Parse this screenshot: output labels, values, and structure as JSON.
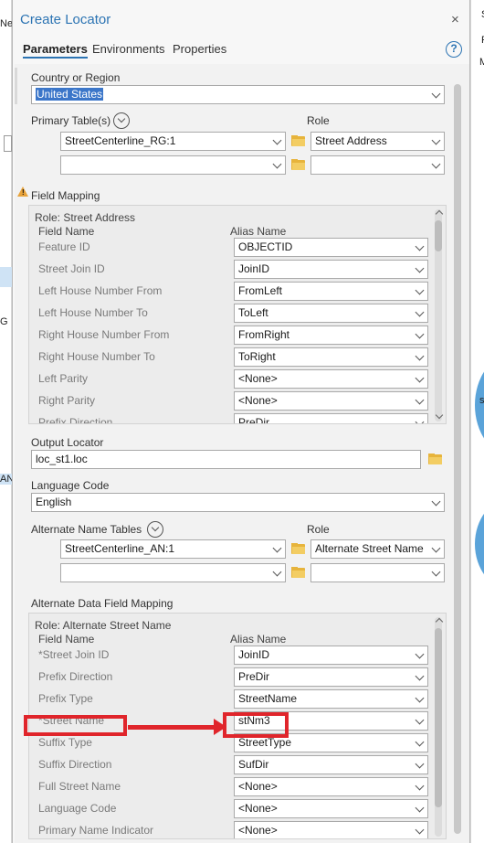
{
  "background": {
    "left_fragments": [
      "Ne",
      "G",
      "AN"
    ],
    "right_fragments": [
      "S",
      "P",
      "M",
      "s"
    ]
  },
  "dialog": {
    "title": "Create Locator",
    "close_glyph": "×",
    "help_glyph": "?",
    "tabs": [
      {
        "label": "Parameters",
        "active": true
      },
      {
        "label": "Environments",
        "active": false
      },
      {
        "label": "Properties",
        "active": false
      }
    ]
  },
  "country": {
    "label": "Country or Region",
    "value": "United States"
  },
  "primary_tables": {
    "label": "Primary Table(s)",
    "role_label": "Role",
    "rows": [
      {
        "table": "StreetCenterline_RG:1",
        "role": "Street Address"
      },
      {
        "table": "",
        "role": ""
      }
    ]
  },
  "field_mapping": {
    "label": "Field Mapping",
    "role_title": "Role: Street Address",
    "col_field": "Field Name",
    "col_alias": "Alias Name",
    "rows": [
      {
        "field": "Feature ID",
        "alias": "OBJECTID"
      },
      {
        "field": "Street Join ID",
        "alias": "JoinID"
      },
      {
        "field": "Left House Number From",
        "alias": "FromLeft"
      },
      {
        "field": "Left House Number To",
        "alias": "ToLeft"
      },
      {
        "field": "Right House Number From",
        "alias": "FromRight"
      },
      {
        "field": "Right House Number To",
        "alias": "ToRight"
      },
      {
        "field": "Left Parity",
        "alias": "<None>"
      },
      {
        "field": "Right Parity",
        "alias": "<None>"
      },
      {
        "field": "Prefix Direction",
        "alias": "PreDir"
      }
    ]
  },
  "output_locator": {
    "label": "Output Locator",
    "value": "loc_st1.loc"
  },
  "language_code": {
    "label": "Language Code",
    "value": "English"
  },
  "alternate_tables": {
    "label": "Alternate Name Tables",
    "role_label": "Role",
    "rows": [
      {
        "table": "StreetCenterline_AN:1",
        "role": "Alternate Street Name"
      },
      {
        "table": "",
        "role": ""
      }
    ]
  },
  "alt_mapping": {
    "label": "Alternate Data Field Mapping",
    "role_title": "Role: Alternate Street Name",
    "col_field": "Field Name",
    "col_alias": "Alias Name",
    "rows": [
      {
        "field": "*Street Join ID",
        "alias": "JoinID"
      },
      {
        "field": "Prefix Direction",
        "alias": "PreDir"
      },
      {
        "field": "Prefix Type",
        "alias": "StreetName"
      },
      {
        "field": "*Street Name",
        "alias": "stNm3"
      },
      {
        "field": "Suffix Type",
        "alias": "StreetType"
      },
      {
        "field": "Suffix Direction",
        "alias": "SufDir"
      },
      {
        "field": "Full Street Name",
        "alias": "<None>"
      },
      {
        "field": "Language Code",
        "alias": "<None>"
      },
      {
        "field": "Primary Name Indicator",
        "alias": "<None>"
      }
    ]
  },
  "colors": {
    "accent": "#2c74b3",
    "annotation_red": "#e0252b",
    "folder": "#e7b43c"
  },
  "icons": [
    "close-icon",
    "help-icon",
    "chevron-down-icon",
    "folder-icon",
    "warning-icon",
    "arrow-annotation"
  ]
}
